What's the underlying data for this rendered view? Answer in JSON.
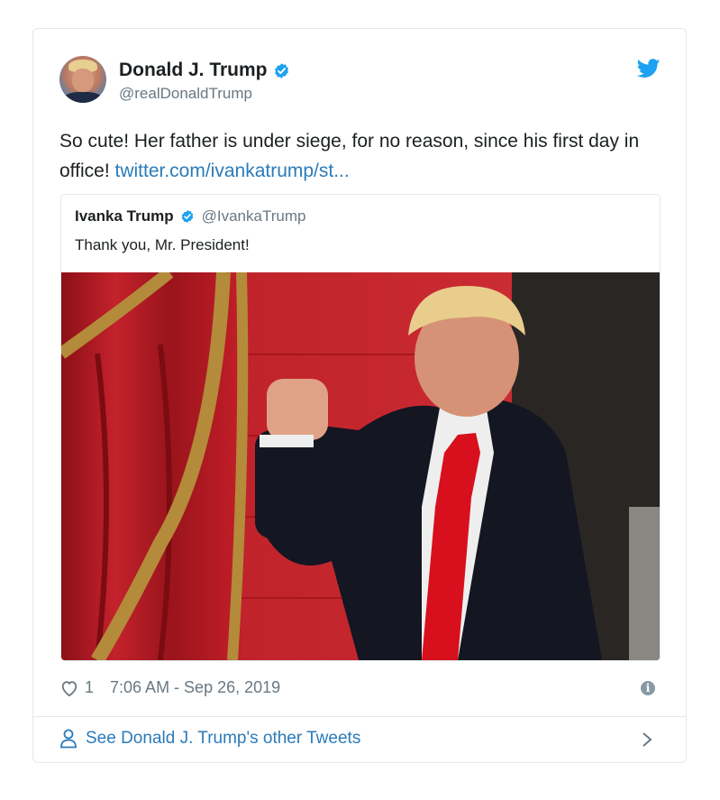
{
  "tweet": {
    "author_name": "Donald J. Trump",
    "author_handle": "@realDonaldTrump",
    "text": "So cute! Her father is under siege, for no reason, since his first day in office! ",
    "link_text": "twitter.com/ivankatrump/st...",
    "likes": "1",
    "timestamp": "7:06 AM - Sep 26, 2019",
    "info_glyph": "i"
  },
  "quoted": {
    "author_name": "Ivanka Trump",
    "author_handle": "@IvankaTrump",
    "text": "Thank you, Mr. President!"
  },
  "footer": {
    "other_tweets_label": "See Donald J. Trump's other Tweets"
  },
  "colors": {
    "brand_blue": "#1da1f2",
    "link": "#2b7bb9",
    "muted": "#697882",
    "border": "#e1e8ed"
  },
  "icons": [
    "twitter-bird-icon",
    "verified-badge-icon",
    "heart-icon",
    "info-icon",
    "person-icon",
    "chevron-right-icon"
  ]
}
